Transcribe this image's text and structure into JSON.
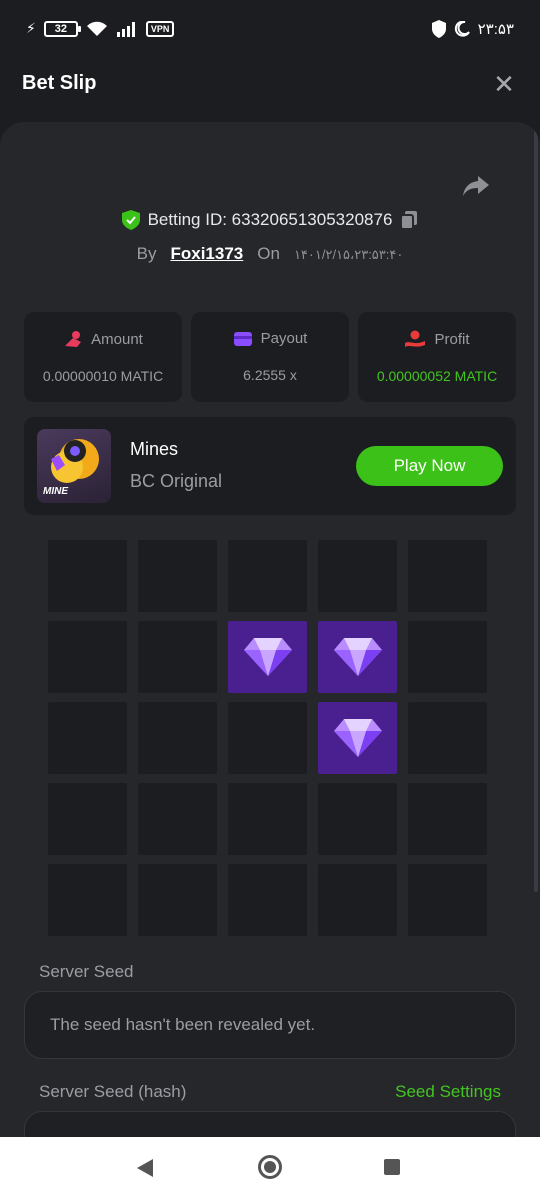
{
  "status": {
    "battery": "32",
    "vpn": "VPN",
    "time": "۲۳:۵۳"
  },
  "header": {
    "title": "Bet Slip",
    "close": "✕"
  },
  "bet": {
    "id_text": "Betting ID: 63320651305320876",
    "by_label": "By",
    "user": "Foxi1373",
    "on_label": "On",
    "date": "۱۴۰۱/۲/۱۵،۲۳:۵۳:۴۰"
  },
  "stats": [
    {
      "label": "Amount",
      "value": "0.00000010 MATIC",
      "icon": "amount-icon",
      "color": "#e83b5e"
    },
    {
      "label": "Payout",
      "value": "6.2555 x",
      "icon": "wallet-icon",
      "color": "#8a4dff"
    },
    {
      "label": "Profit",
      "value": "0.00000052 MATIC",
      "icon": "profit-icon",
      "color": "#e83b3b"
    }
  ],
  "game": {
    "name": "Mines",
    "provider": "BC Original",
    "thumb_label": "MINE",
    "play_label": "Play Now"
  },
  "grid": {
    "rows": 5,
    "cols": 5,
    "cells": [
      "empty",
      "empty",
      "empty",
      "empty",
      "empty",
      "empty",
      "empty",
      "gem",
      "gem",
      "empty",
      "empty",
      "empty",
      "empty",
      "gem",
      "empty",
      "empty",
      "empty",
      "empty",
      "empty",
      "empty",
      "empty",
      "empty",
      "empty",
      "empty",
      "empty"
    ]
  },
  "seeds": {
    "server_seed_label": "Server Seed",
    "server_seed_value": "The seed hasn't been revealed yet.",
    "server_hash_label": "Server Seed (hash)",
    "settings_label": "Seed Settings"
  },
  "colors": {
    "accent_green": "#43c51f",
    "gem_bg": "#4a1f8f",
    "sheet": "#26272b",
    "card": "#1c1d20"
  }
}
